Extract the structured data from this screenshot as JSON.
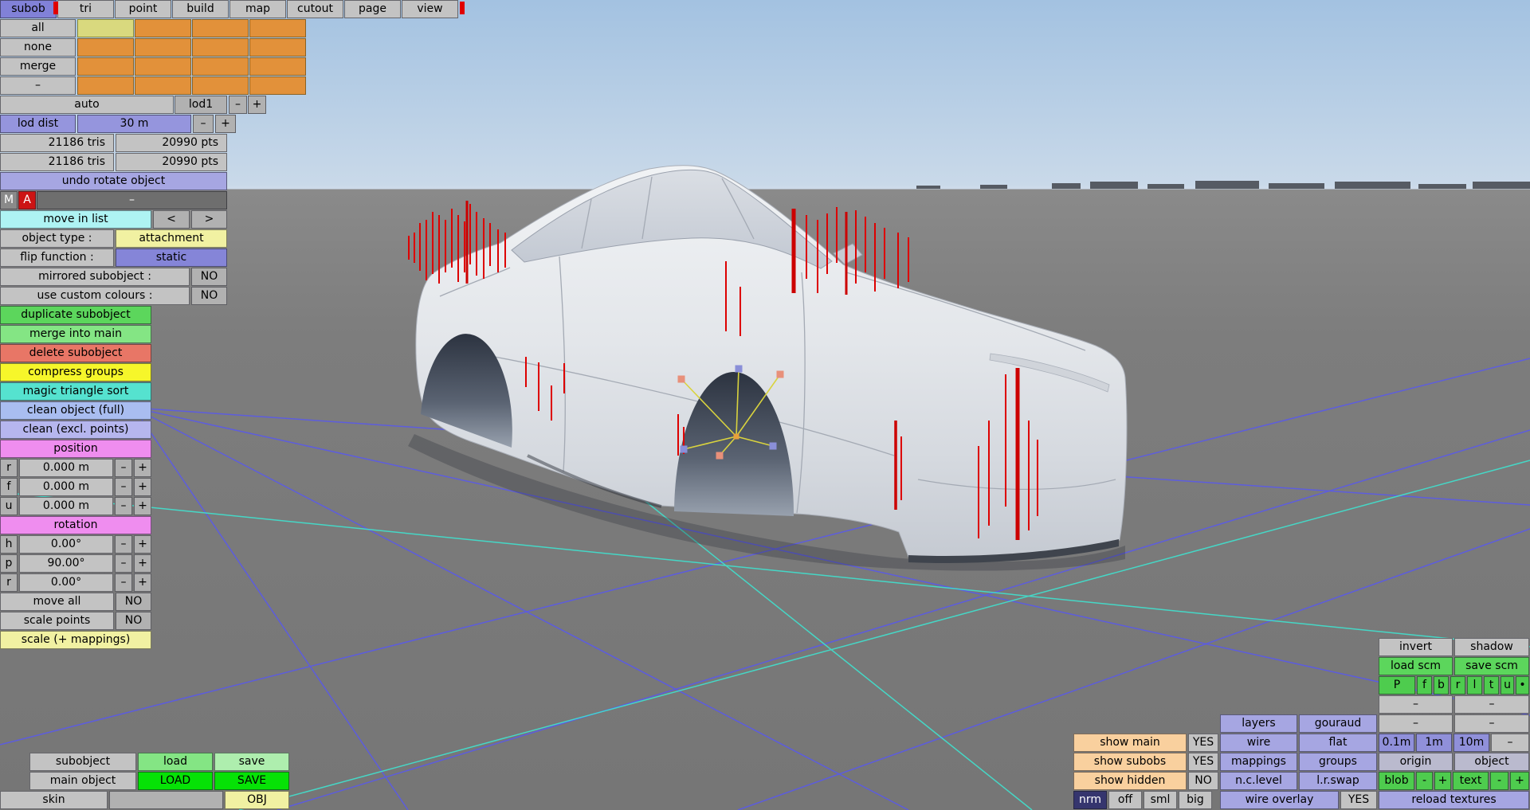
{
  "tabs": {
    "items": [
      "subob",
      "tri",
      "point",
      "build",
      "map",
      "cutout",
      "page",
      "view"
    ],
    "selected": "subob"
  },
  "select_panel": {
    "all": "all",
    "none": "none",
    "merge": "merge",
    "dash": "–"
  },
  "lod": {
    "auto": "auto",
    "lod_name": "lod1",
    "minus": "–",
    "plus": "+",
    "dist_label": "lod dist",
    "dist_value": "30 m"
  },
  "stats": {
    "rows": [
      {
        "tris": "21186 tris",
        "pts": "20990 pts"
      },
      {
        "tris": "21186 tris",
        "pts": "20990 pts"
      }
    ]
  },
  "history": {
    "undo": "undo rotate object",
    "m": "M",
    "a": "A",
    "dash": "–"
  },
  "list_nav": {
    "label": "move in list",
    "prev": "<",
    "next": ">"
  },
  "props": {
    "object_type_label": "object type :",
    "object_type_value": "attachment",
    "flip_label": "flip function :",
    "flip_value": "static",
    "mirrored_label": "mirrored subobject :",
    "mirrored_value": "NO",
    "colours_label": "use custom colours :",
    "colours_value": "NO"
  },
  "actions": {
    "duplicate": "duplicate subobject",
    "merge_main": "merge into main",
    "delete_sub": "delete subobject",
    "compress": "compress groups",
    "magic_sort": "magic triangle sort",
    "clean_full": "clean object (full)",
    "clean_excl": "clean (excl. points)"
  },
  "position": {
    "header": "position",
    "minus": "–",
    "plus": "+",
    "rows": [
      {
        "axis": "r",
        "value": "0.000 m"
      },
      {
        "axis": "f",
        "value": "0.000 m"
      },
      {
        "axis": "u",
        "value": "0.000 m"
      }
    ]
  },
  "rotation": {
    "header": "rotation",
    "rows": [
      {
        "axis": "h",
        "value": "0.00°"
      },
      {
        "axis": "p",
        "value": "90.00°"
      },
      {
        "axis": "r",
        "value": "0.00°"
      }
    ]
  },
  "toggles": {
    "move_all_label": "move all",
    "move_all_value": "NO",
    "scale_points_label": "scale points",
    "scale_points_value": "NO",
    "scale_mappings": "scale (+ mappings)"
  },
  "file_panel": {
    "subobject": "subobject",
    "load": "load",
    "save": "save",
    "main_object": "main object",
    "load_caps": "LOAD",
    "save_caps": "SAVE",
    "skin": "skin",
    "obj": "OBJ"
  },
  "view_panel": {
    "invert": "invert",
    "shadow": "shadow",
    "load_scm": "load scm",
    "save_scm": "save scm",
    "axes": [
      "P",
      "f",
      "b",
      "r",
      "l",
      "t",
      "u",
      "•"
    ],
    "dash": "–",
    "minus": "-",
    "plus": "+",
    "layers": "layers",
    "gouraud": "gouraud",
    "show_main": "show main",
    "show_main_value": "YES",
    "wire": "wire",
    "flat": "flat",
    "grid_01": "0.1m",
    "grid_1": "1m",
    "grid_10": "10m",
    "show_subobs": "show subobs",
    "show_subobs_value": "YES",
    "mappings": "mappings",
    "groups": "groups",
    "origin": "origin",
    "object": "object",
    "show_hidden": "show hidden",
    "show_hidden_value": "NO",
    "nc_level": "n.c.level",
    "lr_swap": "l.r.swap",
    "blob": "blob",
    "text_btn": "text",
    "nrm": "nrm",
    "off": "off",
    "sml": "sml",
    "big": "big",
    "wire_overlay": "wire overlay",
    "wire_overlay_value": "YES",
    "reload_textures": "reload textures"
  },
  "colors": {
    "tab_selected": "#8181d8",
    "grid_blue": "#5858f0",
    "grid_cyan": "#40e2cf",
    "selection_red": "#dd0000",
    "gizmo_yellow": "#d9d33e",
    "ground": "#7b7b7b",
    "sky_top": "#a3c2e1"
  }
}
